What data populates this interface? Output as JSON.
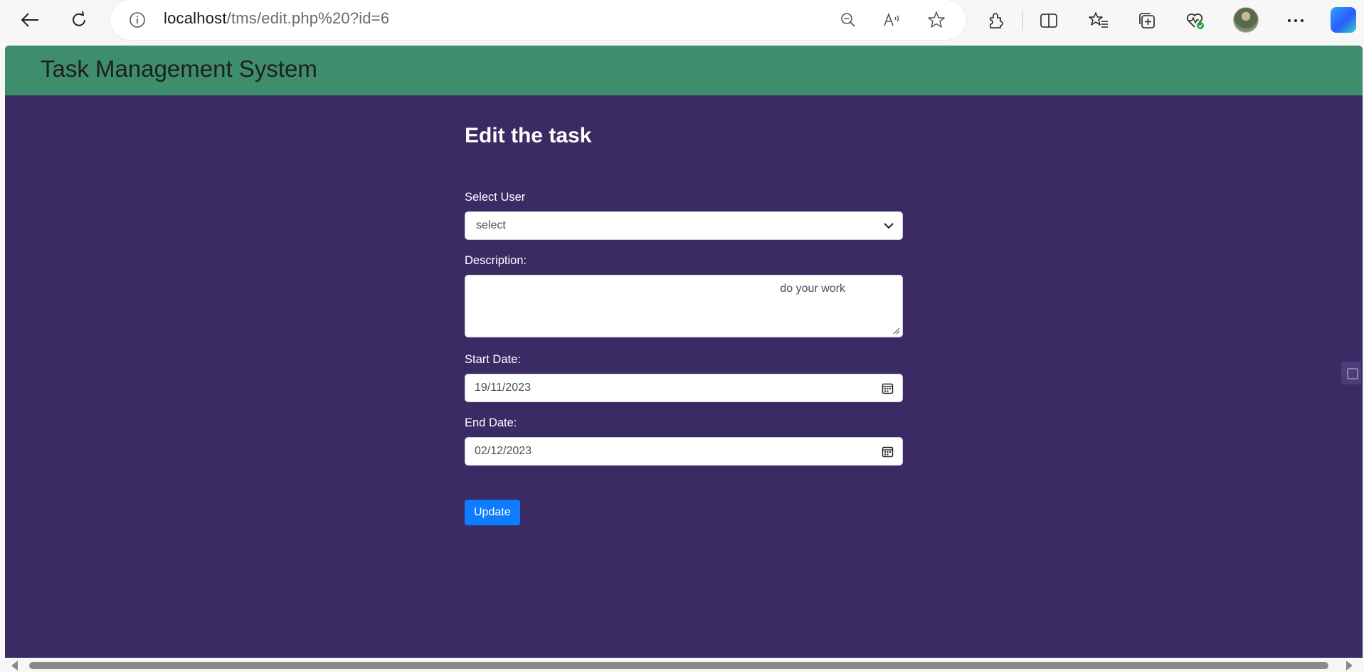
{
  "browser": {
    "url_host": "localhost",
    "url_path": "/tms/edit.php%20?id=6"
  },
  "app": {
    "title": "Task Management System"
  },
  "form": {
    "heading": "Edit the task",
    "user_label": "Select User",
    "user_value": "select",
    "description_label": "Description:",
    "description_value": "do your work",
    "start_label": "Start Date:",
    "start_value": "19/11/2023",
    "end_label": "End Date:",
    "end_value": "02/12/2023",
    "submit_label": "Update"
  },
  "colors": {
    "header_bg": "#3e8e6d",
    "page_bg": "#3a2b64",
    "button_bg": "#0d7cff"
  },
  "icons": [
    "back-arrow-icon",
    "refresh-icon",
    "info-icon",
    "zoom-out-icon",
    "read-aloud-icon",
    "favorite-star-icon",
    "extensions-icon",
    "split-screen-icon",
    "favorites-icon",
    "collections-icon",
    "browser-health-icon",
    "more-icon",
    "copilot-icon",
    "chevron-down-icon",
    "calendar-icon"
  ]
}
